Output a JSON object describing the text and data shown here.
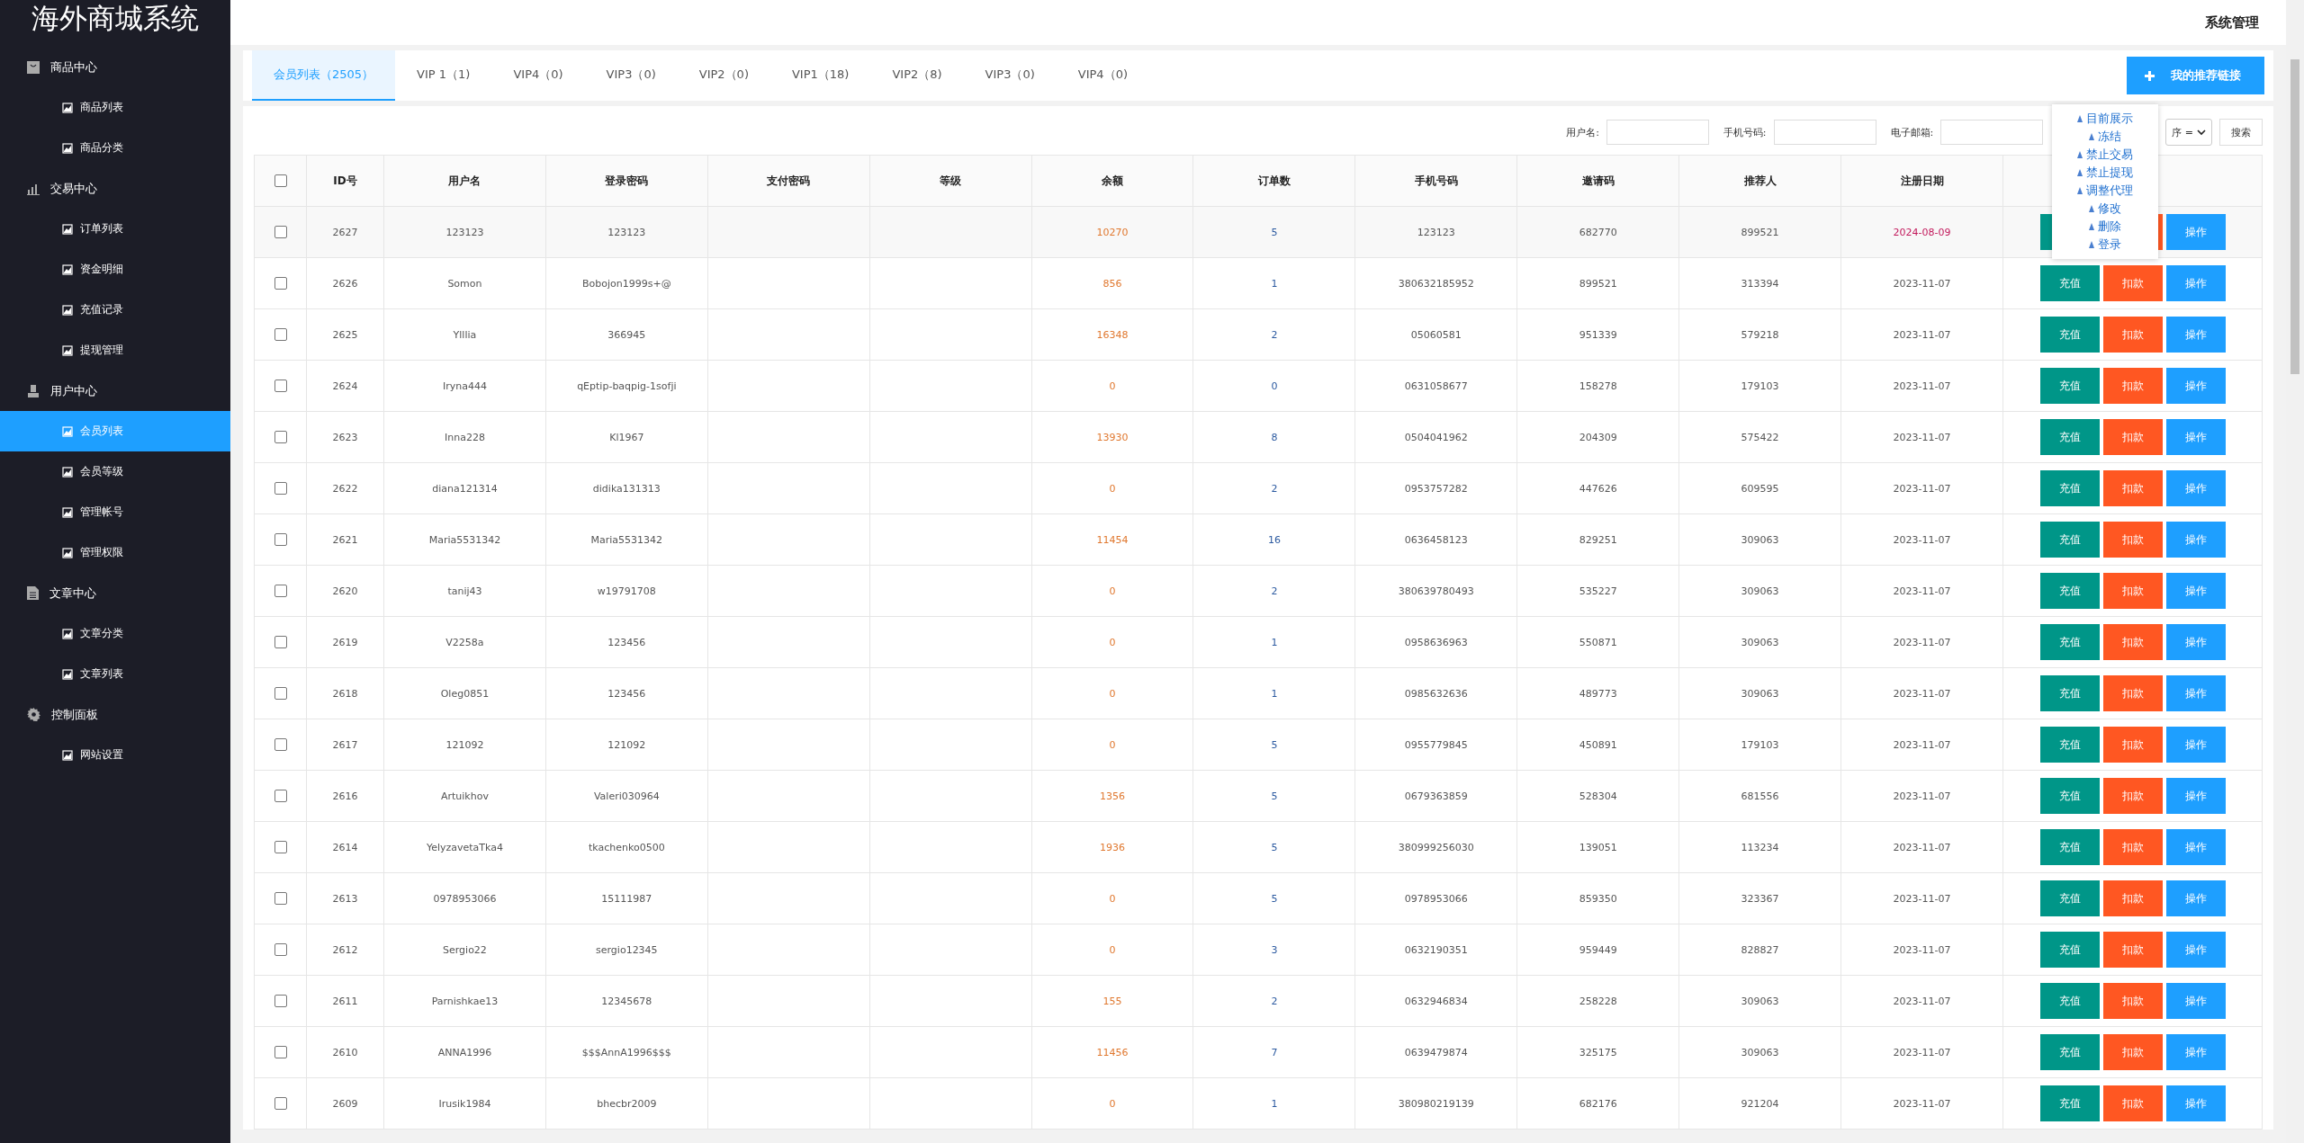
{
  "sidebar": {
    "title": "海外商城系统",
    "groups": [
      {
        "label": "商品中心",
        "items": [
          {
            "label": "商品列表",
            "selected": false
          },
          {
            "label": "商品分类",
            "selected": false
          }
        ]
      },
      {
        "label": "交易中心",
        "items": [
          {
            "label": "订单列表",
            "selected": false
          },
          {
            "label": "资金明细",
            "selected": false
          },
          {
            "label": "充值记录",
            "selected": false
          },
          {
            "label": "提现管理",
            "selected": false
          }
        ]
      },
      {
        "label": "用户中心",
        "items": [
          {
            "label": "会员列表",
            "selected": true
          },
          {
            "label": "会员等级",
            "selected": false
          },
          {
            "label": "管理帐号",
            "selected": false
          },
          {
            "label": "管理权限",
            "selected": false
          }
        ]
      },
      {
        "label": "文章中心",
        "items": [
          {
            "label": "文章分类",
            "selected": false
          },
          {
            "label": "文章列表",
            "selected": false
          }
        ]
      },
      {
        "label": "控制面板",
        "items": [
          {
            "label": "网站设置",
            "selected": false
          }
        ]
      }
    ]
  },
  "header": {
    "title": "系统管理"
  },
  "tabs": [
    {
      "label": "会员列表（2505）",
      "selected": true
    },
    {
      "label": "VIP 1（1)",
      "selected": false
    },
    {
      "label": "VIP4（0)",
      "selected": false
    },
    {
      "label": "VIP3（0)",
      "selected": false
    },
    {
      "label": "VIP2（0)",
      "selected": false
    },
    {
      "label": "VIP1（18)",
      "selected": false
    },
    {
      "label": "VIP2（8)",
      "selected": false
    },
    {
      "label": "VIP3（0)",
      "selected": false
    },
    {
      "label": "VIP4（0)",
      "selected": false
    }
  ],
  "referral_button": "我的推荐链接",
  "filters": [
    {
      "label": "用户名:"
    },
    {
      "label": "手机号码:"
    },
    {
      "label": "电子邮箱:"
    }
  ],
  "sort_select": "序 =",
  "search_button": "搜索",
  "popover": {
    "items": [
      "目前展示",
      "冻结",
      "禁止交易",
      "禁止提现",
      "调整代理",
      "修改",
      "删除",
      "登录"
    ]
  },
  "table": {
    "header_checked": false,
    "columns": [
      "ID号",
      "用户名",
      "登录密码",
      "支付密码",
      "等级",
      "余额",
      "订单数",
      "手机号码",
      "邀请码",
      "推荐人",
      "注册日期"
    ],
    "rows": [
      {
        "checked": false,
        "recent": true,
        "cells": [
          "2627",
          "123123",
          "123123",
          "",
          "",
          "10270",
          "5",
          "123123",
          "682770",
          "899521",
          "2024-08-09"
        ],
        "actions": [
          {
            "kind": "recharge"
          },
          {
            "kind": "deduct"
          },
          {
            "kind": "operate",
            "label": "操作"
          }
        ]
      },
      {
        "checked": false,
        "recent": false,
        "cells": [
          "2626",
          "Somon",
          "Bobojon1999s+@",
          "",
          "",
          "856",
          "1",
          "380632185952",
          "899521",
          "313394",
          "2023-11-07"
        ],
        "actions": [
          {
            "kind": "recharge",
            "label": "充值"
          },
          {
            "kind": "deduct",
            "label": "扣款"
          },
          {
            "kind": "operate",
            "label": "操作"
          }
        ]
      },
      {
        "checked": false,
        "recent": false,
        "cells": [
          "2625",
          "Ylllia",
          "366945",
          "",
          "",
          "16348",
          "2",
          "05060581",
          "951339",
          "579218",
          "2023-11-07"
        ],
        "actions": [
          {
            "kind": "recharge",
            "label": "充值"
          },
          {
            "kind": "deduct",
            "label": "扣款"
          },
          {
            "kind": "operate",
            "label": "操作"
          }
        ]
      },
      {
        "checked": false,
        "recent": false,
        "cells": [
          "2624",
          "Iryna444",
          "qEptip-baqpig-1sofji",
          "",
          "",
          "0",
          "0",
          "0631058677",
          "158278",
          "179103",
          "2023-11-07"
        ],
        "actions": [
          {
            "kind": "recharge",
            "label": "充值"
          },
          {
            "kind": "deduct",
            "label": "扣款"
          },
          {
            "kind": "operate",
            "label": "操作"
          }
        ]
      },
      {
        "checked": false,
        "recent": false,
        "cells": [
          "2623",
          "Inna228",
          "Kl1967",
          "",
          "",
          "13930",
          "8",
          "0504041962",
          "204309",
          "575422",
          "2023-11-07"
        ],
        "actions": [
          {
            "kind": "recharge",
            "label": "充值"
          },
          {
            "kind": "deduct",
            "label": "扣款"
          },
          {
            "kind": "operate",
            "label": "操作"
          }
        ]
      },
      {
        "checked": false,
        "recent": false,
        "cells": [
          "2622",
          "diana121314",
          "didika131313",
          "",
          "",
          "0",
          "2",
          "0953757282",
          "447626",
          "609595",
          "2023-11-07"
        ],
        "actions": [
          {
            "kind": "recharge",
            "label": "充值"
          },
          {
            "kind": "deduct",
            "label": "扣款"
          },
          {
            "kind": "operate",
            "label": "操作"
          }
        ]
      },
      {
        "checked": false,
        "recent": false,
        "cells": [
          "2621",
          "Maria5531342",
          "Maria5531342",
          "",
          "",
          "11454",
          "16",
          "0636458123",
          "829251",
          "309063",
          "2023-11-07"
        ],
        "actions": [
          {
            "kind": "recharge",
            "label": "充值"
          },
          {
            "kind": "deduct",
            "label": "扣款"
          },
          {
            "kind": "operate",
            "label": "操作"
          }
        ]
      },
      {
        "checked": false,
        "recent": false,
        "cells": [
          "2620",
          "tanij43",
          "w19791708",
          "",
          "",
          "0",
          "2",
          "380639780493",
          "535227",
          "309063",
          "2023-11-07"
        ],
        "actions": [
          {
            "kind": "recharge",
            "label": "充值"
          },
          {
            "kind": "deduct",
            "label": "扣款"
          },
          {
            "kind": "operate",
            "label": "操作"
          }
        ]
      },
      {
        "checked": false,
        "recent": false,
        "cells": [
          "2619",
          "V2258a",
          "123456",
          "",
          "",
          "0",
          "1",
          "0958636963",
          "550871",
          "309063",
          "2023-11-07"
        ],
        "actions": [
          {
            "kind": "recharge",
            "label": "充值"
          },
          {
            "kind": "deduct",
            "label": "扣款"
          },
          {
            "kind": "operate",
            "label": "操作"
          }
        ]
      },
      {
        "checked": false,
        "recent": false,
        "cells": [
          "2618",
          "Oleg0851",
          "123456",
          "",
          "",
          "0",
          "1",
          "0985632636",
          "489773",
          "309063",
          "2023-11-07"
        ],
        "actions": [
          {
            "kind": "recharge",
            "label": "充值"
          },
          {
            "kind": "deduct",
            "label": "扣款"
          },
          {
            "kind": "operate",
            "label": "操作"
          }
        ]
      },
      {
        "checked": false,
        "recent": false,
        "cells": [
          "2617",
          "121092",
          "121092",
          "",
          "",
          "0",
          "5",
          "0955779845",
          "450891",
          "179103",
          "2023-11-07"
        ],
        "actions": [
          {
            "kind": "recharge",
            "label": "充值"
          },
          {
            "kind": "deduct",
            "label": "扣款"
          },
          {
            "kind": "operate",
            "label": "操作"
          }
        ]
      },
      {
        "checked": false,
        "recent": false,
        "cells": [
          "2616",
          "Artuikhov",
          "Valeri030964",
          "",
          "",
          "1356",
          "5",
          "0679363859",
          "528304",
          "681556",
          "2023-11-07"
        ],
        "actions": [
          {
            "kind": "recharge",
            "label": "充值"
          },
          {
            "kind": "deduct",
            "label": "扣款"
          },
          {
            "kind": "operate",
            "label": "操作"
          }
        ]
      },
      {
        "checked": false,
        "recent": false,
        "cells": [
          "2614",
          "YelyzavetaTka4",
          "tkachenko0500",
          "",
          "",
          "1936",
          "5",
          "380999256030",
          "139051",
          "113234",
          "2023-11-07"
        ],
        "actions": [
          {
            "kind": "recharge",
            "label": "充值"
          },
          {
            "kind": "deduct",
            "label": "扣款"
          },
          {
            "kind": "operate",
            "label": "操作"
          }
        ]
      },
      {
        "checked": false,
        "recent": false,
        "cells": [
          "2613",
          "0978953066",
          "15111987",
          "",
          "",
          "0",
          "5",
          "0978953066",
          "859350",
          "323367",
          "2023-11-07"
        ],
        "actions": [
          {
            "kind": "recharge",
            "label": "充值"
          },
          {
            "kind": "deduct",
            "label": "扣款"
          },
          {
            "kind": "operate",
            "label": "操作"
          }
        ]
      },
      {
        "checked": false,
        "recent": false,
        "cells": [
          "2612",
          "Sergio22",
          "sergio12345",
          "",
          "",
          "0",
          "3",
          "0632190351",
          "959449",
          "828827",
          "2023-11-07"
        ],
        "actions": [
          {
            "kind": "recharge",
            "label": "充值"
          },
          {
            "kind": "deduct",
            "label": "扣款"
          },
          {
            "kind": "operate",
            "label": "操作"
          }
        ]
      },
      {
        "checked": false,
        "recent": false,
        "cells": [
          "2611",
          "Parnishkae13",
          "12345678",
          "",
          "",
          "155",
          "2",
          "0632946834",
          "258228",
          "309063",
          "2023-11-07"
        ],
        "actions": [
          {
            "kind": "recharge",
            "label": "充值"
          },
          {
            "kind": "deduct",
            "label": "扣款"
          },
          {
            "kind": "operate",
            "label": "操作"
          }
        ]
      },
      {
        "checked": false,
        "recent": false,
        "cells": [
          "2610",
          "ANNA1996",
          "$$$AnnA1996$$$",
          "",
          "",
          "11456",
          "7",
          "0639479874",
          "325175",
          "309063",
          "2023-11-07"
        ],
        "actions": [
          {
            "kind": "recharge",
            "label": "充值"
          },
          {
            "kind": "deduct",
            "label": "扣款"
          },
          {
            "kind": "operate",
            "label": "操作"
          }
        ]
      },
      {
        "checked": false,
        "recent": false,
        "cells": [
          "2609",
          "Irusik1984",
          "bhecbr2009",
          "",
          "",
          "0",
          "1",
          "380980219139",
          "682176",
          "921204",
          "2023-11-07"
        ],
        "actions": [
          {
            "kind": "recharge",
            "label": "充值"
          },
          {
            "kind": "deduct",
            "label": "扣款"
          },
          {
            "kind": "operate",
            "label": "操作"
          }
        ]
      }
    ]
  }
}
